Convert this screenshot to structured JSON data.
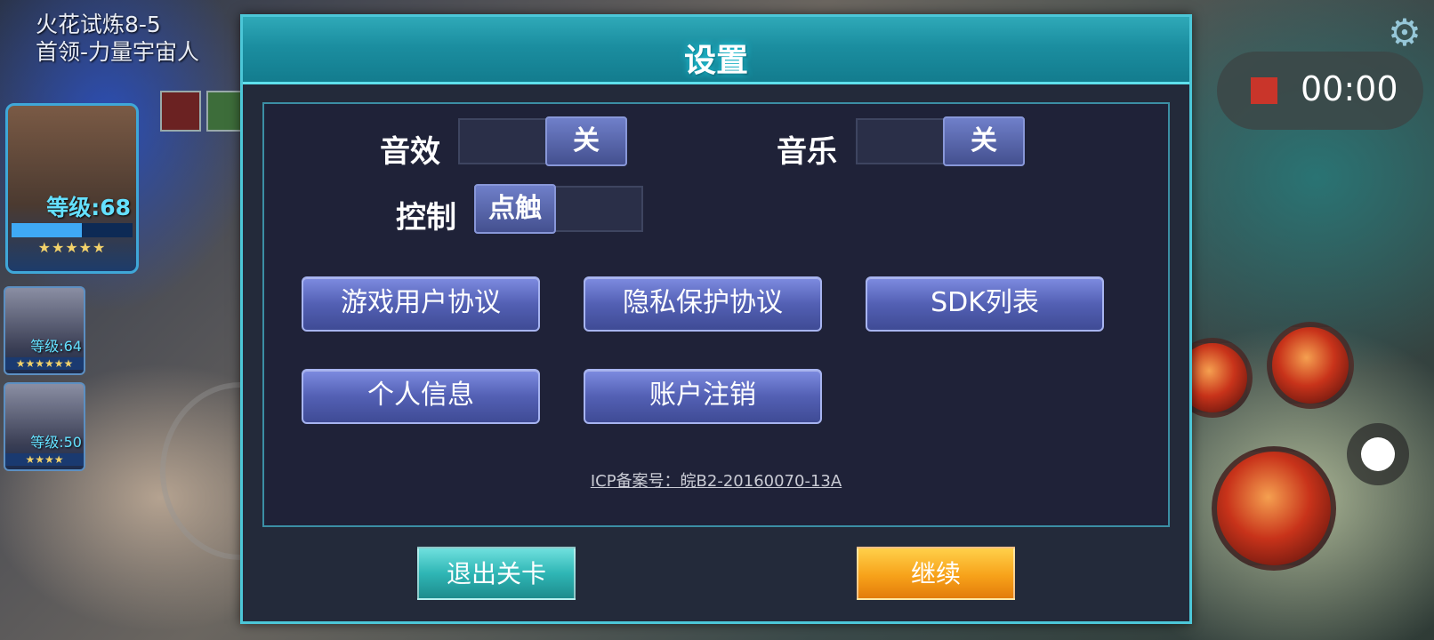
{
  "hud": {
    "stage_line1": "火花试炼8-5",
    "stage_line2": "首领-力量宇宙人",
    "heroes": [
      {
        "level": "等级:68",
        "stars": "★★★★★"
      },
      {
        "level": "等级:64",
        "stars": "★★★★★★"
      },
      {
        "level": "等级:50",
        "stars": "★★★★"
      }
    ],
    "recorder_time": "00:00",
    "recorder_stop_color": "#c9352a"
  },
  "dialog": {
    "title": "设置",
    "sound_effect": {
      "label": "音效",
      "state": "关"
    },
    "music": {
      "label": "音乐",
      "state": "关"
    },
    "control": {
      "label": "控制",
      "state": "点触"
    },
    "buttons": [
      {
        "label": "游戏用户协议"
      },
      {
        "label": "隐私保护协议"
      },
      {
        "label": "SDK列表"
      },
      {
        "label": "个人信息"
      },
      {
        "label": "账户注销"
      }
    ],
    "icp": "ICP备案号：皖B2-20160070-13A",
    "exit_label": "退出关卡",
    "continue_label": "继续"
  },
  "colors": {
    "header_accent": "#2fa9b8",
    "panel_button": "#5360b4",
    "exit_button": "#2fb6b5",
    "continue_button": "#f7a21a"
  }
}
